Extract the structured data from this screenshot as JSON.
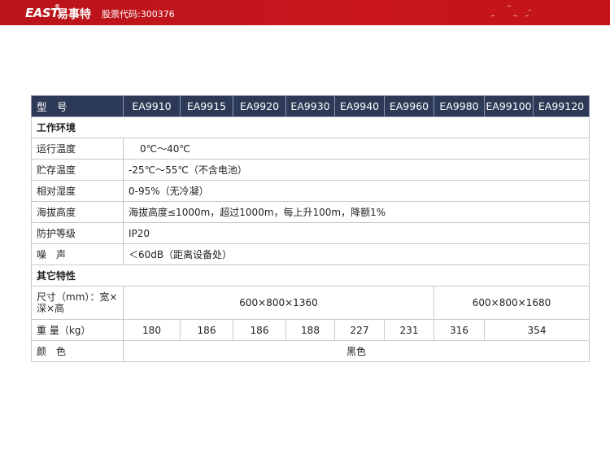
{
  "header": {
    "logo_text": "EAST",
    "logo_mark": "®",
    "brand_cn": "易事特",
    "stock_code": "股票代码:300376"
  },
  "table": {
    "columns": [
      "型　号",
      "EA9910",
      "EA9915",
      "EA9920",
      "EA9930",
      "EA9940",
      "EA9960",
      "EA9980",
      "EA99100",
      "EA99120"
    ],
    "section_env": "工作环境",
    "rows_env": [
      {
        "label": "运行温度",
        "value": "0℃～40℃"
      },
      {
        "label": "贮存温度",
        "value": "-25℃～55℃（不含电池）"
      },
      {
        "label": "相对湿度",
        "value": "0-95%（无冷凝）"
      },
      {
        "label": "海拔高度",
        "value": "海拔高度≤1000m，超过1000m，每上升100m，降额1%"
      },
      {
        "label": "防护等级",
        "value": "IP20"
      },
      {
        "label": "噪　声",
        "value": "＜60dB（距离设备处）"
      }
    ],
    "section_other": "其它特性",
    "size_label": "尺寸（mm）：宽×深×高",
    "size_values": [
      "600×800×1360",
      "600×800×1680"
    ],
    "weight_label": "重 量（kg）",
    "weight_values": [
      "180",
      "186",
      "186",
      "188",
      "227",
      "231",
      "316",
      "354"
    ],
    "color_label": "颜　色",
    "color_value": "黑色"
  }
}
